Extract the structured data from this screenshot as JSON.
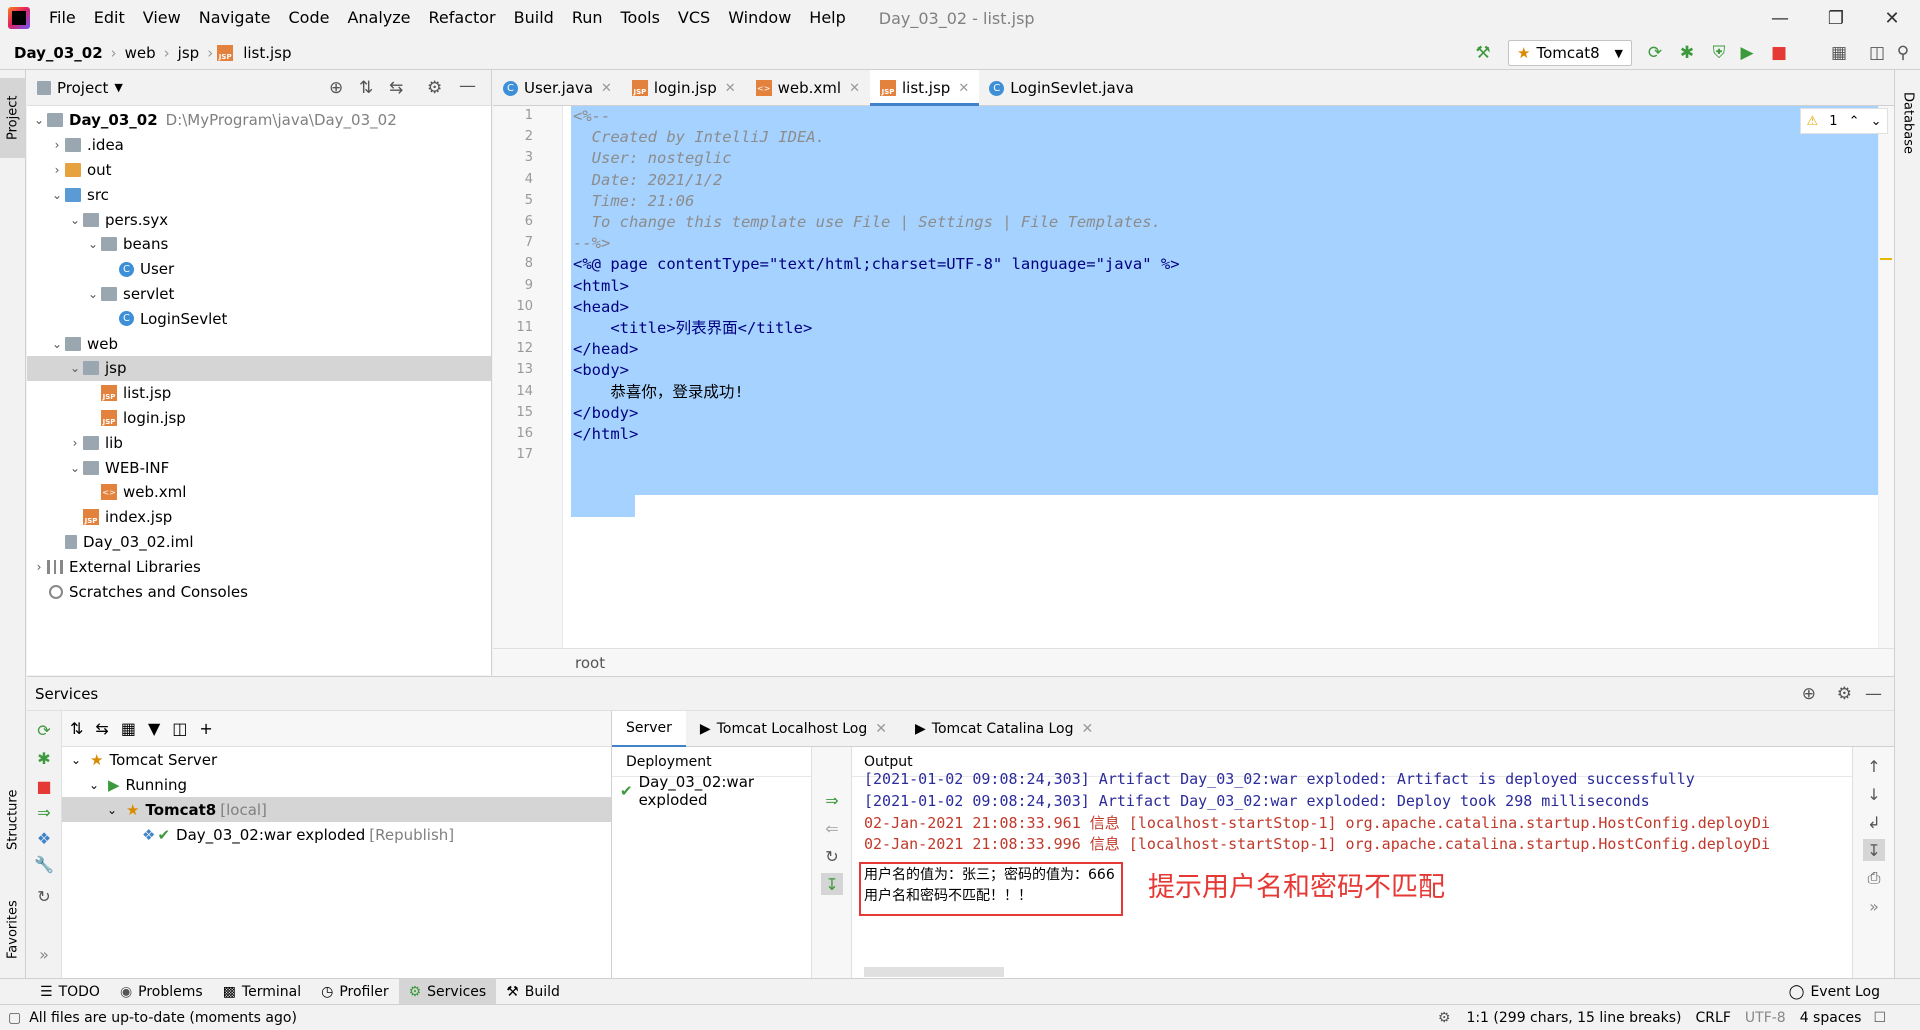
{
  "menu": {
    "items": [
      "File",
      "Edit",
      "View",
      "Navigate",
      "Code",
      "Analyze",
      "Refactor",
      "Build",
      "Run",
      "Tools",
      "VCS",
      "Window",
      "Help"
    ],
    "window_title": "Day_03_02 - list.jsp"
  },
  "breadcrumb": {
    "project": "Day_03_02",
    "items": [
      "web",
      "jsp",
      "list.jsp"
    ]
  },
  "run_config": "Tomcat8",
  "project_panel": {
    "title": "Project",
    "tree": [
      {
        "label": "Day_03_02",
        "extra": "D:\\MyProgram\\java\\Day_03_02"
      },
      {
        "label": ".idea"
      },
      {
        "label": "out"
      },
      {
        "label": "src"
      },
      {
        "label": "pers.syx"
      },
      {
        "label": "beans"
      },
      {
        "label": "User"
      },
      {
        "label": "servlet"
      },
      {
        "label": "LoginSevlet"
      },
      {
        "label": "web"
      },
      {
        "label": "jsp"
      },
      {
        "label": "list.jsp"
      },
      {
        "label": "login.jsp"
      },
      {
        "label": "lib"
      },
      {
        "label": "WEB-INF"
      },
      {
        "label": "web.xml"
      },
      {
        "label": "index.jsp"
      },
      {
        "label": "Day_03_02.iml"
      },
      {
        "label": "External Libraries"
      },
      {
        "label": "Scratches and Consoles"
      }
    ]
  },
  "editor_tabs": [
    "User.java",
    "login.jsp",
    "web.xml",
    "list.jsp",
    "LoginSevlet.java"
  ],
  "editor": {
    "lines": [
      "<%--",
      "  Created by IntelliJ IDEA.",
      "  User: nosteglic",
      "  Date: 2021/1/2",
      "  Time: 21:06",
      "  To change this template use File | Settings | File Templates.",
      "--%>",
      "<%@ page contentType=\"text/html;charset=UTF-8\" language=\"java\" %>",
      "<html>",
      "<head>",
      "    <title>列表界面</title>",
      "</head>",
      "<body>",
      "    恭喜你，登录成功!",
      "</body>",
      "</html>",
      ""
    ],
    "warnings": "1",
    "breadcrumb": "root"
  },
  "left_stripe": {
    "project": "Project",
    "structure": "Structure",
    "favorites": "Favorites"
  },
  "right_stripe": {
    "database": "Database"
  },
  "services": {
    "title": "Services",
    "tree": {
      "server": "Tomcat Server",
      "running": "Running",
      "tomcat": "Tomcat8",
      "tomcat_tag": "[local]",
      "artifact": "Day_03_02:war exploded",
      "artifact_tag": "[Republish]"
    },
    "tabs": [
      "Server",
      "Tomcat Localhost Log",
      "Tomcat Catalina Log"
    ],
    "deployment_header": "Deployment",
    "deployment_item": "Day_03_02:war exploded",
    "output_header": "Output",
    "output_lines": [
      "[2021-01-02 09:08:24,303] Artifact Day_03_02:war exploded: Artifact is deployed successfully",
      "[2021-01-02 09:08:24,303] Artifact Day_03_02:war exploded: Deploy took 298 milliseconds",
      "02-Jan-2021 21:08:33.961 信息 [localhost-startStop-1] org.apache.catalina.startup.HostConfig.deployDi",
      "02-Jan-2021 21:08:33.996 信息 [localhost-startStop-1] org.apache.catalina.startup.HostConfig.deployDi",
      "用户名的值为：张三；密码的值为：666",
      "用户名和密码不匹配！！！"
    ],
    "annotation": "提示用户名和密码不匹配"
  },
  "bottom_tabs": [
    "TODO",
    "Problems",
    "Terminal",
    "Profiler",
    "Services",
    "Build"
  ],
  "event_log": "Event Log",
  "status": {
    "message": "All files are up-to-date (moments ago)",
    "position": "1:1 (299 chars, 15 line breaks)",
    "line_sep": "CRLF",
    "encoding": "UTF-8",
    "indent": "4 spaces"
  }
}
